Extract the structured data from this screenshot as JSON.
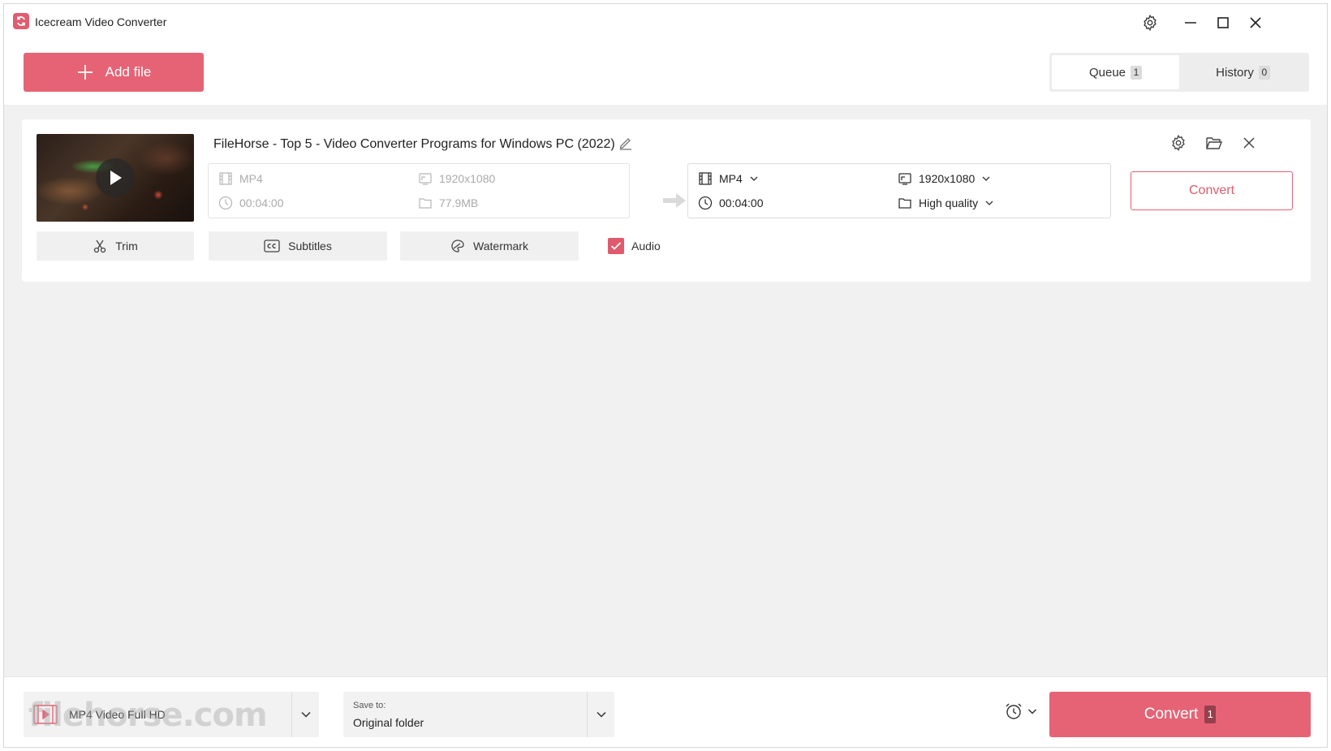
{
  "app": {
    "title": "Icecream Video Converter"
  },
  "header": {
    "add_file_label": "Add file",
    "tabs": [
      {
        "label": "Queue",
        "count": "1",
        "active": true
      },
      {
        "label": "History",
        "count": "0",
        "active": false
      }
    ]
  },
  "file": {
    "title": "FileHorse - Top 5 - Video Converter Programs for Windows PC (2022)",
    "source": {
      "format": "MP4",
      "resolution": "1920x1080",
      "duration": "00:04:00",
      "size": "77.9MB"
    },
    "output": {
      "format": "MP4",
      "resolution": "1920x1080",
      "duration": "00:04:00",
      "quality": "High quality"
    },
    "convert_label": "Convert",
    "tools": {
      "trim": "Trim",
      "subtitles": "Subtitles",
      "watermark": "Watermark",
      "audio": "Audio",
      "audio_checked": true
    }
  },
  "footer": {
    "preset": "MP4 Video Full HD",
    "save_to_label": "Save to:",
    "save_to_value": "Original folder",
    "convert_label": "Convert",
    "convert_count": "1",
    "watermark_text": "filehorse.com"
  },
  "colors": {
    "accent": "#e56375",
    "background": "#f1f1f1"
  }
}
